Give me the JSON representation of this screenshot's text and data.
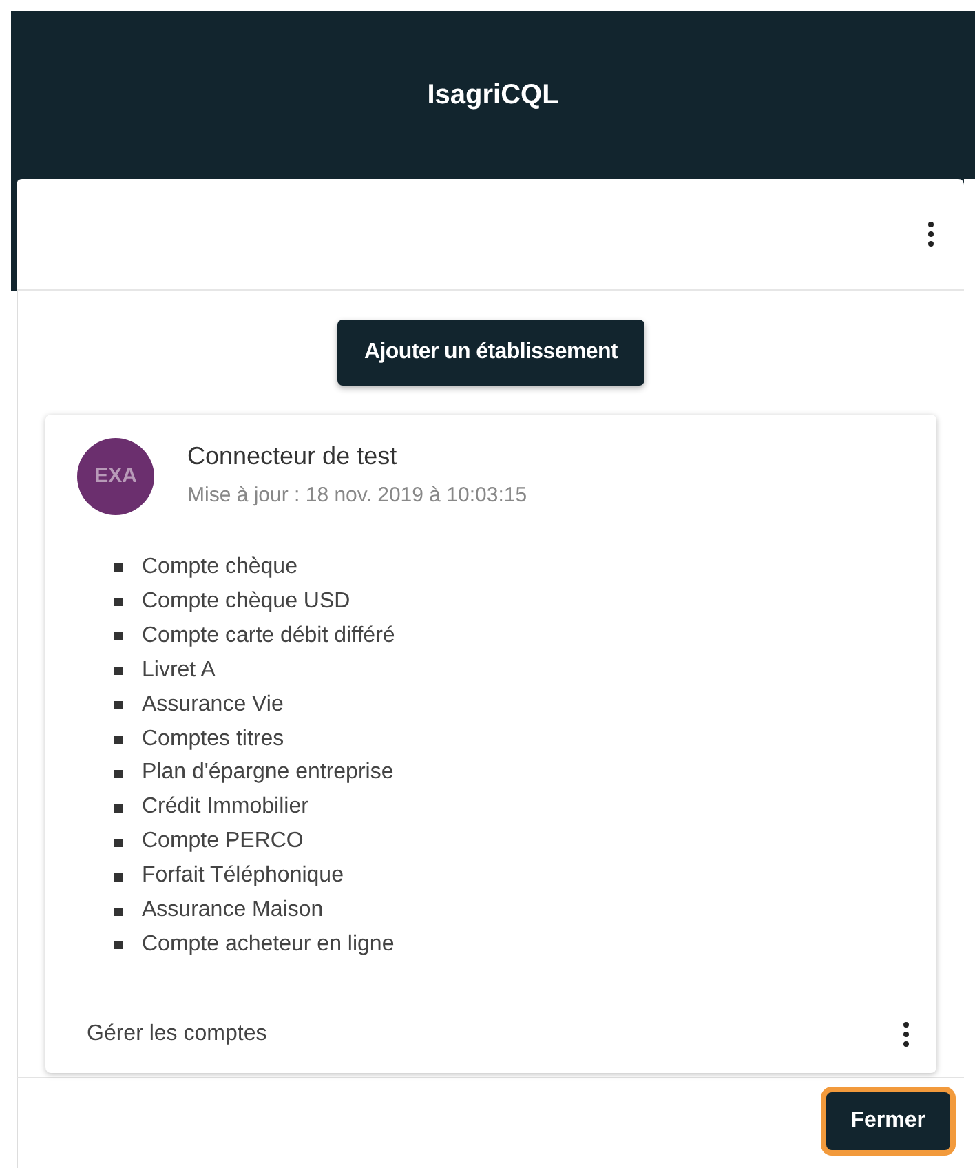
{
  "header": {
    "title": "IsagriCQL"
  },
  "add_button": {
    "label": "Ajouter un établissement"
  },
  "connector": {
    "avatar": "EXA",
    "name": "Connecteur de test",
    "updated": "Mise à jour : 18 nov. 2019 à 10:03:15",
    "accounts": [
      "Compte chèque",
      "Compte chèque USD",
      "Compte carte débit différé",
      "Livret A",
      "Assurance Vie",
      "Comptes titres",
      "Plan d'épargne entreprise",
      "Crédit Immobilier",
      "Compte PERCO",
      "Forfait Téléphonique",
      "Assurance Maison",
      "Compte acheteur en ligne"
    ],
    "manage_link": "Gérer les comptes"
  },
  "footer": {
    "close_button": {
      "label": "Fermer",
      "focused": true
    }
  }
}
